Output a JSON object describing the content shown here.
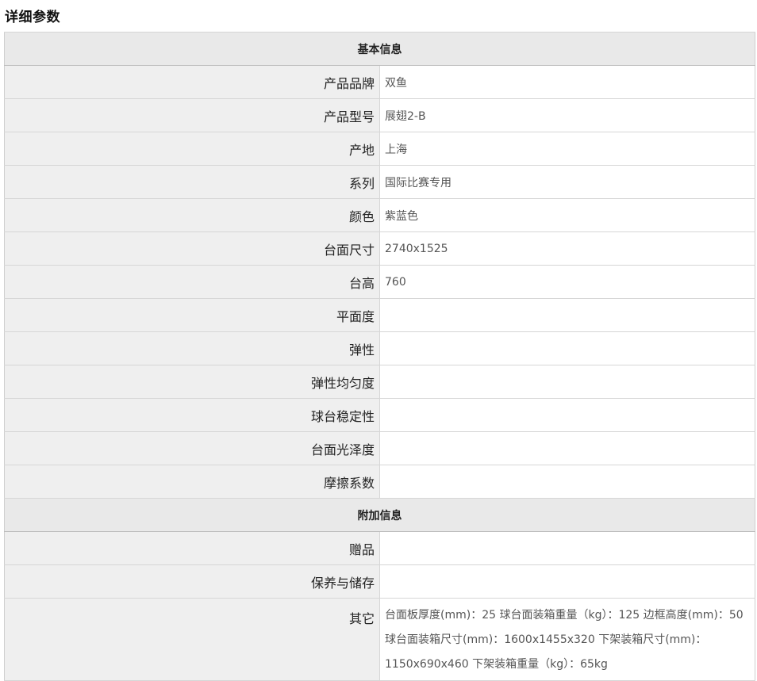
{
  "page_title": "详细参数",
  "sections": [
    {
      "title": "基本信息",
      "rows": [
        {
          "label": "产品品牌",
          "value": "双鱼"
        },
        {
          "label": "产品型号",
          "value": "展翅2-B"
        },
        {
          "label": "产地",
          "value": "上海"
        },
        {
          "label": "系列",
          "value": "国际比赛专用"
        },
        {
          "label": "颜色",
          "value": "紫蓝色"
        },
        {
          "label": "台面尺寸",
          "value": "2740x1525"
        },
        {
          "label": "台高",
          "value": "760"
        },
        {
          "label": "平面度",
          "value": ""
        },
        {
          "label": "弹性",
          "value": ""
        },
        {
          "label": "弹性均匀度",
          "value": ""
        },
        {
          "label": "球台稳定性",
          "value": ""
        },
        {
          "label": "台面光泽度",
          "value": ""
        },
        {
          "label": "摩擦系数",
          "value": ""
        }
      ]
    },
    {
      "title": "附加信息",
      "rows": [
        {
          "label": "赠品",
          "value": ""
        },
        {
          "label": "保养与储存",
          "value": ""
        },
        {
          "label": "其它",
          "value": "台面板厚度(mm)：25 球台面装箱重量（kg）：125 边框高度(mm)：50 球台面装箱尺寸(mm)：1600x1455x320 下架装箱尺寸(mm)：1150x690x460 下架装箱重量（kg）：65kg"
        }
      ]
    }
  ]
}
